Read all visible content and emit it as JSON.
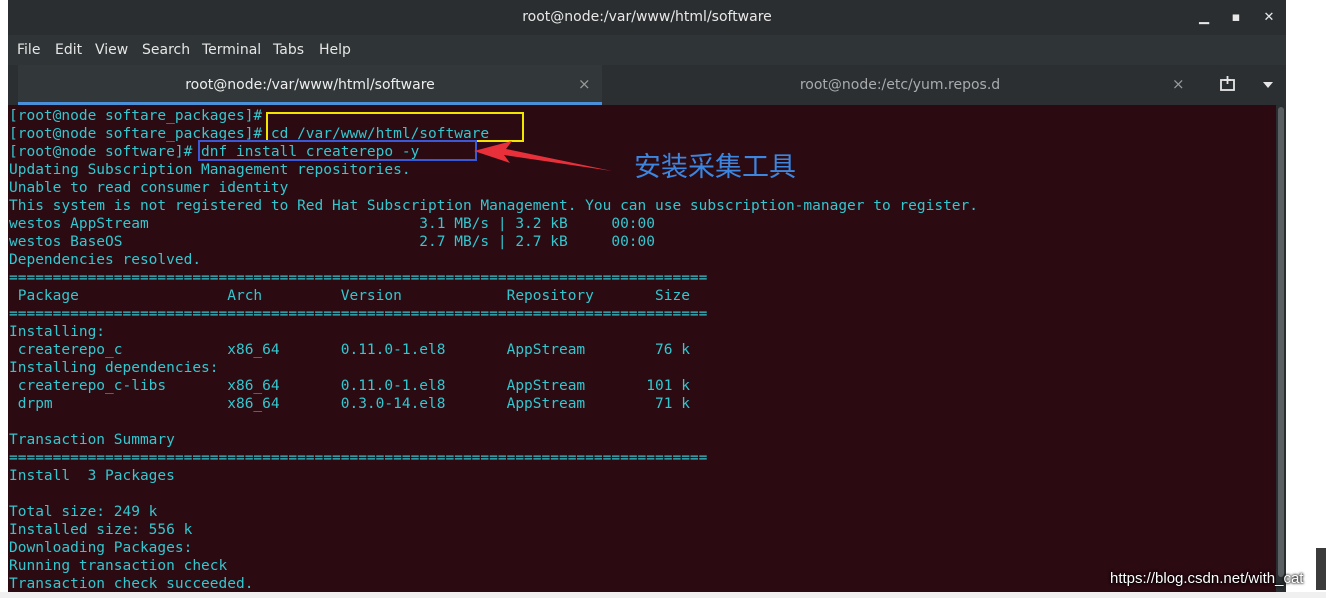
{
  "window": {
    "title": "root@node:/var/www/html/software",
    "minimize_glyph": "▁",
    "maximize_glyph": "▪",
    "close_glyph": "✕"
  },
  "menu": [
    "File",
    "Edit",
    "View",
    "Search",
    "Terminal",
    "Tabs",
    "Help"
  ],
  "tabs": [
    {
      "label": "root@node:/var/www/html/software",
      "active": true
    },
    {
      "label": "root@node:/etc/yum.repos.d",
      "active": false
    }
  ],
  "tab_close_glyph": "×",
  "tab_tools": {
    "new_tab_icon": "new-tab-icon",
    "dropdown_icon": "chevron-down-icon"
  },
  "terminal": {
    "lines": [
      "[root@node softare_packages]# ",
      "[root@node softare_packages]# cd /var/www/html/software",
      "[root@node software]# dnf install createrepo -y",
      "Updating Subscription Management repositories.",
      "Unable to read consumer identity",
      "This system is not registered to Red Hat Subscription Management. You can use subscription-manager to register.",
      "westos AppStream                               3.1 MB/s | 3.2 kB     00:00",
      "westos BaseOS                                  2.7 MB/s | 2.7 kB     00:00",
      "Dependencies resolved.",
      "================================================================================",
      " Package                 Arch         Version            Repository       Size",
      "================================================================================",
      "Installing:",
      " createrepo_c            x86_64       0.11.0-1.el8       AppStream        76 k",
      "Installing dependencies:",
      " createrepo_c-libs       x86_64       0.11.0-1.el8       AppStream       101 k",
      " drpm                    x86_64       0.3.0-14.el8       AppStream        71 k",
      "",
      "Transaction Summary",
      "================================================================================",
      "Install  3 Packages",
      "",
      "Total size: 249 k",
      "Installed size: 556 k",
      "Downloading Packages:",
      "Running transaction check",
      "Transaction check succeeded."
    ]
  },
  "annotation": {
    "text": "安装采集工具",
    "color": "#3d86e0"
  },
  "watermark": "https://blog.csdn.net/with_cat",
  "colors": {
    "terminal_bg": "#2b0a12",
    "terminal_fg": "#33c7cf",
    "highlight_yellow": "#f1e500",
    "highlight_blue": "#3b59d6",
    "arrow_red": "#e8303a"
  }
}
